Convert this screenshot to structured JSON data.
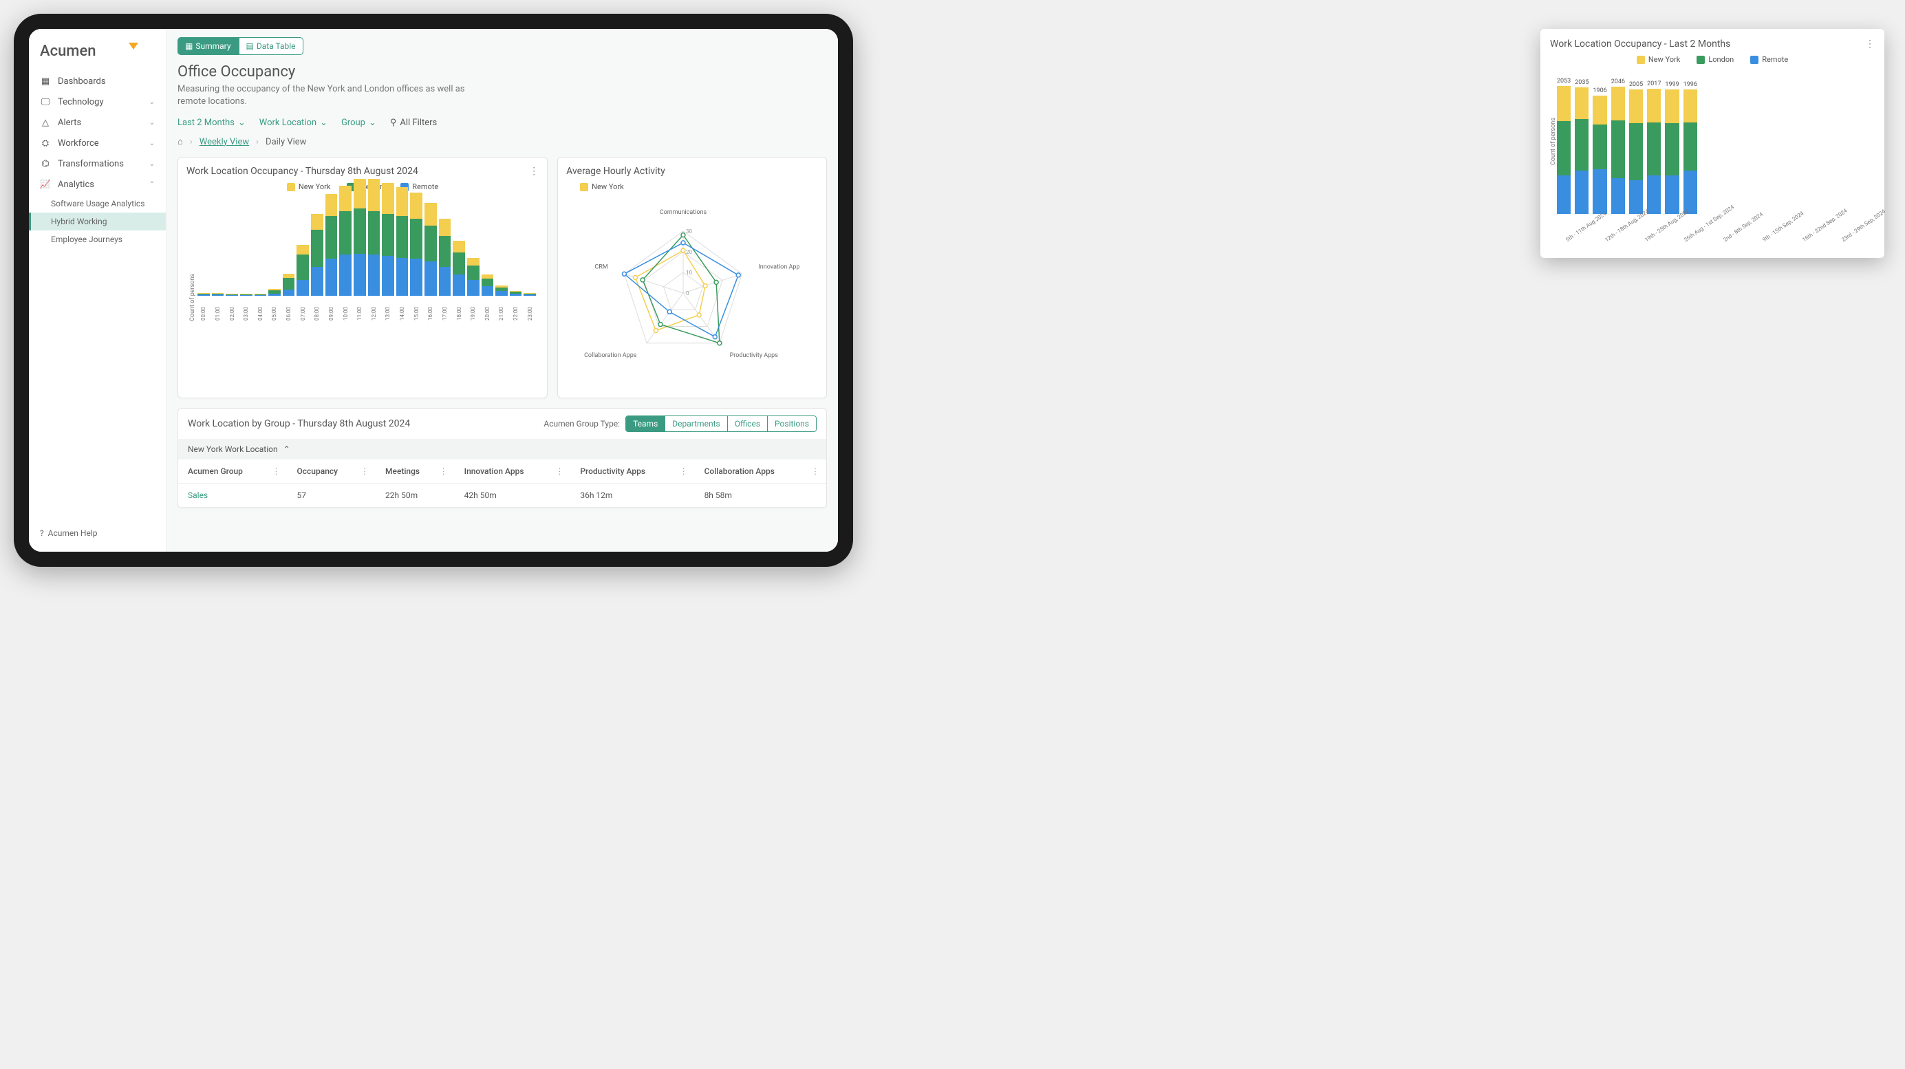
{
  "brand": "Acumen",
  "nav": {
    "items": [
      {
        "label": "Dashboards",
        "icon": "grid"
      },
      {
        "label": "Technology",
        "icon": "monitor"
      },
      {
        "label": "Alerts",
        "icon": "alert"
      },
      {
        "label": "Workforce",
        "icon": "users"
      },
      {
        "label": "Transformations",
        "icon": "nodes"
      },
      {
        "label": "Analytics",
        "icon": "chart",
        "expanded": true
      }
    ],
    "subs": [
      {
        "label": "Software Usage Analytics"
      },
      {
        "label": "Hybrid Working",
        "active": true
      },
      {
        "label": "Employee Journeys"
      }
    ],
    "help": "Acumen Help"
  },
  "toggle": {
    "summary": "Summary",
    "datatable": "Data Table"
  },
  "page": {
    "title": "Office Occupancy",
    "subtitle": "Measuring the occupancy of the New York and London offices as well as remote locations."
  },
  "filters": {
    "f1": "Last 2 Months",
    "f2": "Work Location",
    "f3": "Group",
    "all": "All Filters"
  },
  "crumbs": {
    "home": "⌂",
    "weekly": "Weekly View",
    "daily": "Daily View"
  },
  "colors": {
    "ny": "#f3ce4f",
    "ldn": "#3a9b5e",
    "rem": "#3a8ee0"
  },
  "legend": {
    "ny": "New York",
    "ldn": "London",
    "rem": "Remote"
  },
  "chart1": {
    "title": "Work Location Occupancy - Thursday 8th August 2024",
    "ylabel": "Count of persons"
  },
  "chart2": {
    "title": "Average Hourly Activity",
    "legend": "New York",
    "axes": [
      "Innovation Apps",
      "Productivity Apps",
      "Collaboration Apps",
      "CRM",
      "Communications"
    ]
  },
  "group": {
    "title": "Work Location by Group - Thursday 8th August 2024",
    "label": "Acumen Group Type:",
    "tabs": [
      "Teams",
      "Departments",
      "Offices",
      "Positions"
    ],
    "section": "New York Work Location",
    "cols": [
      "Acumen Group",
      "Occupancy",
      "Meetings",
      "Innovation Apps",
      "Productivity Apps",
      "Collaboration Apps"
    ],
    "row": {
      "group": "Sales",
      "occ": "57",
      "meet": "22h 50m",
      "inno": "42h 50m",
      "prod": "36h 12m",
      "collab": "8h 58m"
    }
  },
  "popup": {
    "title": "Work Location Occupancy - Last 2 Months",
    "ylabel": "Count of persons"
  },
  "chart_data": [
    {
      "id": "daily_stacked",
      "type": "bar_stacked",
      "title": "Work Location Occupancy - Thursday 8th August 2024",
      "ylabel": "Count of persons",
      "categories": [
        "00:00",
        "01:00",
        "02:00",
        "03:00",
        "04:00",
        "05:00",
        "06:00",
        "07:00",
        "08:00",
        "09:00",
        "10:00",
        "11:00",
        "12:00",
        "13:00",
        "14:00",
        "15:00",
        "16:00",
        "17:00",
        "18:00",
        "19:00",
        "20:00",
        "21:00",
        "22:00",
        "23:00"
      ],
      "series": [
        {
          "name": "Remote",
          "color": "#3a8ee0",
          "values": [
            3,
            3,
            2,
            2,
            2,
            5,
            12,
            30,
            55,
            70,
            78,
            80,
            78,
            75,
            72,
            70,
            65,
            55,
            40,
            30,
            18,
            10,
            5,
            3
          ]
        },
        {
          "name": "London",
          "color": "#3a9b5e",
          "values": [
            2,
            2,
            1,
            1,
            1,
            6,
            22,
            48,
            70,
            80,
            82,
            85,
            82,
            80,
            78,
            75,
            68,
            58,
            42,
            28,
            15,
            6,
            3,
            2
          ]
        },
        {
          "name": "New York",
          "color": "#f3ce4f",
          "values": [
            1,
            1,
            1,
            1,
            1,
            3,
            8,
            18,
            30,
            42,
            48,
            55,
            60,
            58,
            55,
            50,
            42,
            32,
            22,
            14,
            8,
            4,
            2,
            1
          ]
        }
      ]
    },
    {
      "id": "weekly_stacked",
      "type": "bar_stacked",
      "title": "Work Location Occupancy - Last 2 Months",
      "ylabel": "Count of persons",
      "categories": [
        "5th - 11th Aug 2024",
        "12th - 18th Aug, 2024",
        "19th - 25th Aug, 2024",
        "26th Aug - 1st Sep, 2024",
        "2nd - 8th Sep, 2024",
        "9th - 15th Sep, 2024",
        "16th - 22nd Sep, 2024",
        "23rd - 29th Sep, 2024"
      ],
      "totals": [
        2053,
        2035,
        1906,
        2046,
        2005,
        2017,
        1999,
        1996
      ],
      "series": [
        {
          "name": "Remote",
          "color": "#3a8ee0",
          "values": [
            620,
            700,
            720,
            580,
            540,
            620,
            620,
            700
          ]
        },
        {
          "name": "London",
          "color": "#3a9b5e",
          "values": [
            870,
            830,
            720,
            920,
            920,
            850,
            840,
            770
          ]
        },
        {
          "name": "New York",
          "color": "#f3ce4f",
          "values": [
            563,
            505,
            466,
            546,
            545,
            547,
            539,
            526
          ]
        }
      ]
    },
    {
      "id": "radar",
      "type": "radar",
      "title": "Average Hourly Activity",
      "axes": [
        "Communications",
        "Innovation Apps",
        "Productivity Apps",
        "Collaboration Apps",
        "CRM"
      ],
      "ticks": [
        10,
        20,
        30
      ],
      "series": [
        {
          "name": "New York",
          "color": "#f3ce4f",
          "values": [
            22,
            12,
            14,
            24,
            26
          ]
        },
        {
          "name": "London",
          "color": "#3a9b5e",
          "values": [
            30,
            18,
            32,
            20,
            22
          ]
        },
        {
          "name": "Remote",
          "color": "#3a8ee0",
          "values": [
            26,
            30,
            28,
            12,
            32
          ]
        }
      ]
    }
  ]
}
